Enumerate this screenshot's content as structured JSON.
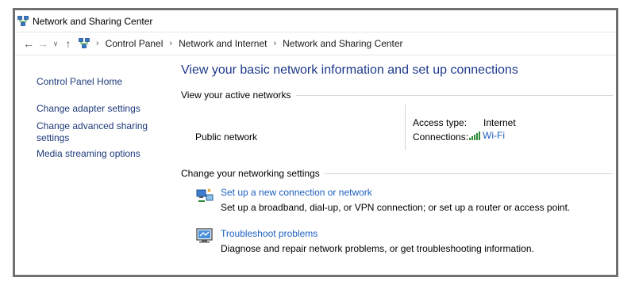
{
  "window": {
    "title": "Network and Sharing Center"
  },
  "address_bar": {
    "breadcrumbs": [
      "Control Panel",
      "Network and Internet",
      "Network and Sharing Center"
    ]
  },
  "sidebar": {
    "items": [
      {
        "label": "Control Panel Home"
      },
      {
        "label": "Change adapter settings"
      },
      {
        "label": "Change advanced sharing settings"
      },
      {
        "label": "Media streaming options"
      }
    ]
  },
  "main": {
    "title": "View your basic network information and set up connections",
    "active_networks_heading": "View your active networks",
    "network_name": "Public network",
    "access_type_label": "Access type:",
    "access_type_value": "Internet",
    "connections_label": "Connections:",
    "connections_value": "Wi-Fi",
    "settings_heading": "Change your networking settings",
    "tasks": [
      {
        "icon": "network-setup-icon",
        "link": "Set up a new connection or network",
        "description": "Set up a broadband, dial-up, or VPN connection; or set up a router or access point."
      },
      {
        "icon": "troubleshoot-icon",
        "link": "Troubleshoot problems",
        "description": "Diagnose and repair network problems, or get troubleshooting information."
      }
    ]
  },
  "colors": {
    "link": "#1e5fbf",
    "title": "#1e3a8a",
    "sidebar_link": "#1e3a7a",
    "frame": "#707070"
  }
}
